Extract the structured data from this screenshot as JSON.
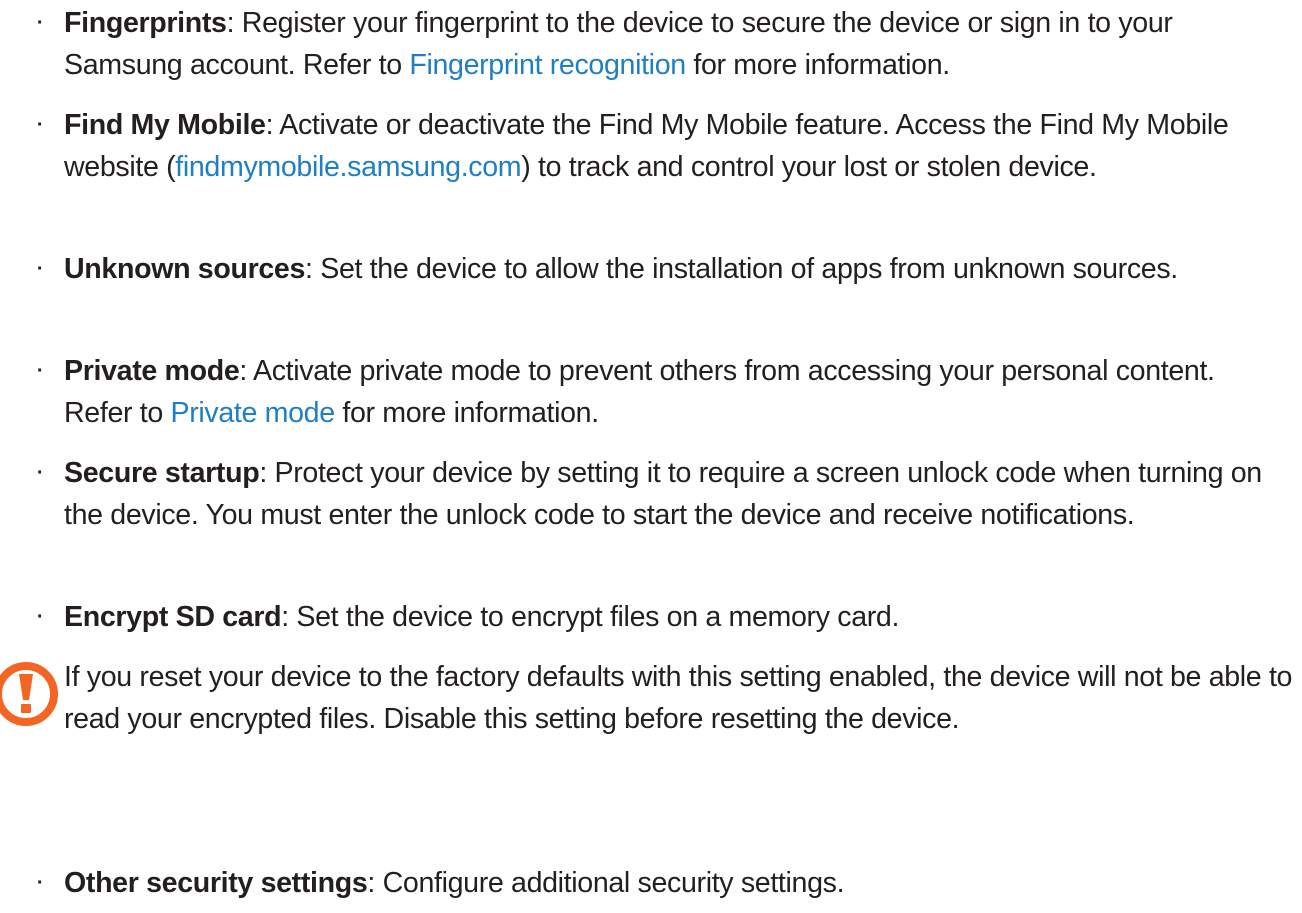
{
  "items": [
    {
      "term": "Fingerprints",
      "text_before": ": Register your fingerprint to the device to secure the device or sign in to your Samsung account. Refer to ",
      "link": "Fingerprint recognition",
      "text_after": " for more information."
    },
    {
      "term": "Find My Mobile",
      "text_before": ": Activate or deactivate the Find My Mobile feature. Access the Find My Mobile website (",
      "link": "findmymobile.samsung.com",
      "text_after": ") to track and control your lost or stolen device."
    },
    {
      "term": "Unknown sources",
      "text": ": Set the device to allow the installation of apps from unknown sources."
    },
    {
      "term": "Private mode",
      "text_before": ": Activate private mode to prevent others from accessing your personal content. Refer to ",
      "link": "Private mode",
      "text_after": " for more information."
    },
    {
      "term": "Secure startup",
      "text": ": Protect your device by setting it to require a screen unlock code when turning on the device. You must enter the unlock code to start the device and receive notifications."
    },
    {
      "term": "Encrypt SD card",
      "text": ": Set the device to encrypt files on a memory card."
    },
    {
      "term": "Other security settings",
      "text": ": Configure additional security settings."
    }
  ],
  "caution": {
    "icon": "caution-icon",
    "text": "If you reset your device to the factory defaults with this setting enabled, the device will not be able to read your encrypted files. Disable this setting before resetting the device."
  },
  "colors": {
    "text": "#231f20",
    "link": "#1f7fc4",
    "caution": "#f26522"
  }
}
